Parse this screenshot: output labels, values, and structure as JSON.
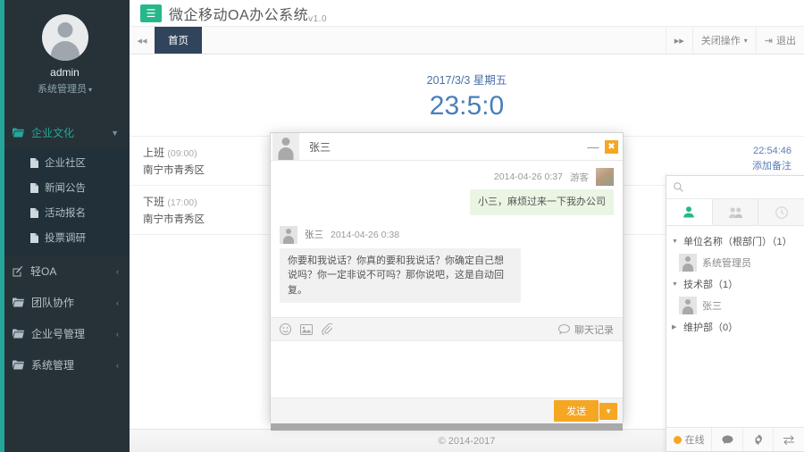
{
  "sidebar": {
    "profile": {
      "name": "admin",
      "role": "系统管理员",
      "avatar_icon": "user-avatar-icon"
    },
    "groups": [
      {
        "label": "企业文化",
        "icon": "folder-open-icon",
        "arrow": "chevron-down-icon",
        "expanded": true,
        "items": [
          {
            "label": "企业社区",
            "icon": "file-icon"
          },
          {
            "label": "新闻公告",
            "icon": "file-icon"
          },
          {
            "label": "活动报名",
            "icon": "file-icon"
          },
          {
            "label": "投票调研",
            "icon": "file-icon"
          }
        ]
      },
      {
        "label": "轻OA",
        "icon": "edit-square-icon",
        "arrow": "chevron-left-icon",
        "expanded": false
      },
      {
        "label": "团队协作",
        "icon": "folder-icon",
        "arrow": "chevron-left-icon",
        "expanded": false
      },
      {
        "label": "企业号管理",
        "icon": "folder-icon",
        "arrow": "chevron-left-icon",
        "expanded": false
      },
      {
        "label": "系统管理",
        "icon": "folder-icon",
        "arrow": "chevron-left-icon",
        "expanded": false
      }
    ]
  },
  "topbar": {
    "logo_icon": "hamburger-menu-icon",
    "title": "微企移动OA办公系统",
    "version": "v1.0"
  },
  "tabbar": {
    "collapse_icon": "double-chevron-left-icon",
    "tabs": [
      {
        "label": "首页",
        "active": true
      }
    ],
    "close_ops_label": "关闭操作",
    "close_ops_caret": "caret-down-icon",
    "expand_icon": "double-chevron-right-icon",
    "logout_label": "退出",
    "logout_icon": "sign-out-icon"
  },
  "content": {
    "clock": {
      "date": "2017/3/3  星期五",
      "time": "23:5:0"
    },
    "punches": [
      {
        "label": "上班",
        "time": "(09:00)",
        "address": "南宁市青秀区",
        "stamp": "22:54:46",
        "note": "添加备注"
      },
      {
        "label": "下班",
        "time": "(17:00)",
        "address": "南宁市青秀区",
        "stamp": "",
        "note": ""
      }
    ],
    "footer": "© 2014-2017"
  },
  "chat": {
    "title": "张三",
    "avatar_icon": "user-avatar-icon",
    "minimize_icon": "minimize-icon",
    "close_icon": "close-icon",
    "messages": [
      {
        "side": "right",
        "name": "游客",
        "time": "2014-04-26 0:37",
        "text": "小三，麻烦过来一下我办公司",
        "avatar_icon": "photo-avatar-icon"
      },
      {
        "side": "left",
        "name": "张三",
        "time": "2014-04-26 0:38",
        "text": "你要和我说话？你真的要和我说话？你确定自己想说吗？你一定非说不可吗？那你说吧，这是自动回复。",
        "avatar_icon": "user-avatar-icon"
      }
    ],
    "tools": [
      {
        "icon": "emoji-smiley-icon"
      },
      {
        "icon": "image-icon"
      },
      {
        "icon": "paperclip-icon"
      }
    ],
    "history_label": "聊天记录",
    "history_icon": "chat-bubble-icon",
    "input_value": "",
    "input_placeholder": "",
    "send_label": "发送",
    "send_caret_icon": "caret-down-icon"
  },
  "contacts": {
    "search": {
      "value": "",
      "placeholder": "",
      "icon": "search-icon"
    },
    "tabs": [
      {
        "icon": "person-icon",
        "active": true
      },
      {
        "icon": "group-icon",
        "active": false
      },
      {
        "icon": "clock-icon",
        "active": false
      }
    ],
    "tree": [
      {
        "type": "group",
        "label": "单位名称（根部门）（1）",
        "tri": "caret-down-icon"
      },
      {
        "type": "person",
        "label": "系统管理员",
        "avatar_icon": "user-avatar-icon"
      },
      {
        "type": "group",
        "label": "技术部（1）",
        "tri": "caret-down-icon"
      },
      {
        "type": "person",
        "label": "张三",
        "avatar_icon": "user-avatar-icon"
      },
      {
        "type": "group",
        "label": "维护部（0）",
        "tri": "caret-right-icon"
      }
    ],
    "status": {
      "online_label": "在线",
      "online_dot_color": "#f5a623",
      "items": [
        {
          "icon": "chat-bubble-icon"
        },
        {
          "icon": "gear-icon"
        },
        {
          "icon": "switch-user-icon"
        }
      ]
    }
  },
  "colors": {
    "sidebar_bg": "#263238",
    "accent_green": "#26a69a",
    "logo_green": "#26b88a",
    "tab_active": "#30455c",
    "clock_blue": "#4a7ebb",
    "orange": "#f5a623",
    "bubble_green": "#eaf5e4"
  }
}
